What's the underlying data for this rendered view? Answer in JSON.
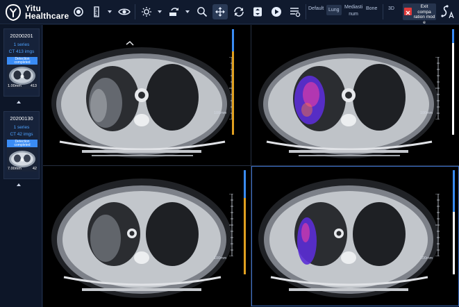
{
  "app": {
    "logo_line1": "Yitu",
    "logo_line2": "Healthcare"
  },
  "toolbar": {
    "tools": [
      "record-icon",
      "ruler-icon",
      "eye-icon",
      "brightness-icon",
      "rotate-icon",
      "zoom-icon",
      "pan-icon",
      "refresh-icon",
      "stack-icon",
      "play-icon",
      "list-settings-icon"
    ],
    "presets": {
      "default": "Default",
      "lung": "Lung",
      "mediastinum_line1": "Mediasti",
      "mediastinum_line2": "num",
      "bone": "Bone",
      "three_d": "3D"
    },
    "exit_label_line1": "Exit compa",
    "exit_label_line2": "ration mod",
    "exit_label_line3": "e"
  },
  "sidebar": {
    "series": [
      {
        "date": "20200201",
        "count": "1 series",
        "imgs": "CT 413 imgs",
        "badge_line1": "Detection",
        "badge_line2": "completed",
        "thickness": "1.00mm",
        "num": "413"
      },
      {
        "date": "20200130",
        "count": "1 series",
        "imgs": "CT 42 imgs",
        "badge_line1": "Detection",
        "badge_line2": "completed",
        "thickness": "7.00mm",
        "num": "42"
      }
    ]
  },
  "viewer": {
    "scale_label": "100mm",
    "colors": {
      "accent": "#3a8cf5",
      "slice_yellow": "#e0a020",
      "overlay_purple": "#5b2ed6",
      "overlay_hot": "#ff3fa0"
    }
  }
}
